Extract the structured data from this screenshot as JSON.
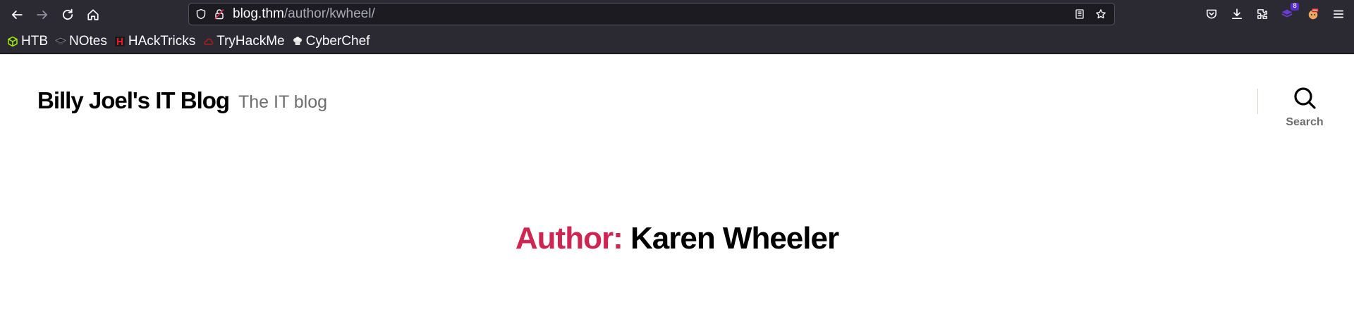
{
  "browser": {
    "url": {
      "host": "blog.thm",
      "path": "/author/kwheel/"
    },
    "nav_icons": [
      "back-arrow-icon",
      "forward-arrow-icon",
      "reload-icon",
      "home-icon"
    ],
    "toolbar_icons": [
      "pocket-icon",
      "downloads-icon",
      "extensions-icon",
      "extension-badge-icon",
      "extension-avatar-icon",
      "menu-icon"
    ],
    "extension_badge_count": "8",
    "bookmarks": [
      {
        "label": "HTB",
        "icon": "htb-cube-icon",
        "color": "#9fef00"
      },
      {
        "label": "NOtes",
        "icon": "notes-hat-icon",
        "color": "#1c1b22"
      },
      {
        "label": "HAckTricks",
        "icon": "hacktricks-icon",
        "color": "#e8192c"
      },
      {
        "label": "TryHackMe",
        "icon": "tryhackme-icon",
        "color": "#b01b1b"
      },
      {
        "label": "CyberChef",
        "icon": "chef-hat-icon",
        "color": "#e0e0e0"
      }
    ]
  },
  "site": {
    "title": "Billy Joel's IT Blog",
    "description": "The IT blog",
    "search_label": "Search",
    "accent_color": "#cd2653"
  },
  "archive": {
    "prefix": "Author:",
    "name": "Karen Wheeler"
  }
}
